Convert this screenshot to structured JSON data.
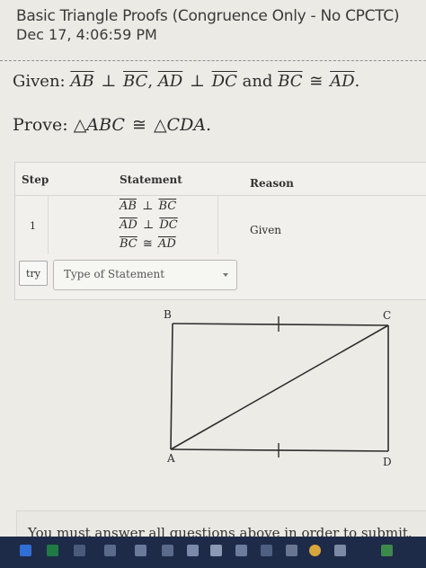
{
  "header": {
    "title": "Basic Triangle Proofs (Congruence Only - No CPCTC)",
    "date": "Dec 17, 4:06:59 PM"
  },
  "given": {
    "label": "Given:",
    "seg1": "AB",
    "perp1": "⊥",
    "seg2": "BC",
    "comma": ",",
    "seg3": "AD",
    "perp2": "⊥",
    "seg4": "DC",
    "and": "and",
    "seg5": "BC",
    "cong": "≅",
    "seg6": "AD",
    "period": "."
  },
  "prove": {
    "label": "Prove:",
    "tri1": "△ABC",
    "cong": "≅",
    "tri2": "△CDA",
    "period": "."
  },
  "table": {
    "headers": {
      "step": "Step",
      "statement": "Statement",
      "reason": "Reason"
    },
    "rows": [
      {
        "step": "1",
        "statements": [
          {
            "a": "AB",
            "op": "⊥",
            "b": "BC"
          },
          {
            "a": "AD",
            "op": "⊥",
            "b": "DC"
          },
          {
            "a": "BC",
            "op": "≅",
            "b": "AD"
          }
        ],
        "reason": "Given"
      }
    ],
    "try_label": "try",
    "select_placeholder": "Type of Statement"
  },
  "diagram": {
    "labels": {
      "A": "A",
      "B": "B",
      "C": "C",
      "D": "D"
    }
  },
  "footer": {
    "message": "You must answer all questions above in order to submit."
  },
  "taskbar": {
    "icons": [
      "dropbox-icon",
      "excel-icon",
      "app-icon",
      "app-icon",
      "app-icon",
      "app-icon",
      "pc-icon",
      "cx-icon",
      "app-icon",
      "app-icon",
      "app-icon",
      "chrome-icon",
      "app-icon",
      "app-icon"
    ]
  }
}
